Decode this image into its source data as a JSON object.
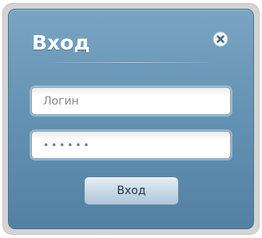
{
  "dialog": {
    "title": "Вход",
    "close_icon": "close-icon"
  },
  "form": {
    "login_placeholder": "Логин",
    "password_value": "••••••",
    "submit_label": "Вход"
  },
  "colors": {
    "panel": "#6593b3",
    "frame": "#d4d4d4",
    "button": "#c9d9e6",
    "close_icon": "#3f6b8a"
  }
}
